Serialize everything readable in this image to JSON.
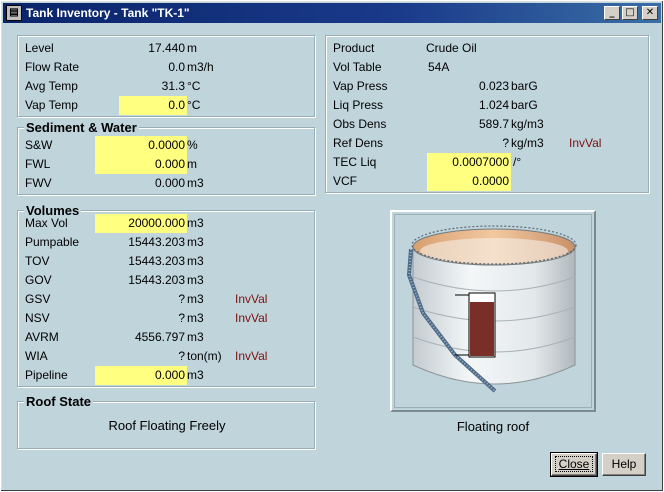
{
  "window": {
    "title": "Tank Inventory - Tank \"TK-1\"",
    "minimize_glyph": "_",
    "maximize_glyph": "□",
    "close_glyph": "✕"
  },
  "measurements": {
    "level": {
      "label": "Level",
      "value": "17.440",
      "unit": "m"
    },
    "flow_rate": {
      "label": "Flow Rate",
      "value": "0.0",
      "unit": "m3/h"
    },
    "avg_temp": {
      "label": "Avg Temp",
      "value": "31.3",
      "unit": "°C"
    },
    "vap_temp": {
      "label": "Vap Temp",
      "value": "0.0",
      "unit": "°C"
    }
  },
  "sediment": {
    "title": "Sediment & Water",
    "sw": {
      "label": "S&W",
      "value": "0.0000",
      "unit": "%"
    },
    "fwl": {
      "label": "FWL",
      "value": "0.000",
      "unit": "m"
    },
    "fwv": {
      "label": "FWV",
      "value": "0.000",
      "unit": "m3"
    }
  },
  "volumes": {
    "title": "Volumes",
    "max_vol": {
      "label": "Max Vol",
      "value": "20000.000",
      "unit": "m3"
    },
    "pumpable": {
      "label": "Pumpable",
      "value": "15443.203",
      "unit": "m3"
    },
    "tov": {
      "label": "TOV",
      "value": "15443.203",
      "unit": "m3"
    },
    "gov": {
      "label": "GOV",
      "value": "15443.203",
      "unit": "m3"
    },
    "gsv": {
      "label": "GSV",
      "value": "?",
      "unit": "m3",
      "status": "InvVal"
    },
    "nsv": {
      "label": "NSV",
      "value": "?",
      "unit": "m3",
      "status": "InvVal"
    },
    "avrm": {
      "label": "AVRM",
      "value": "4556.797",
      "unit": "m3"
    },
    "wia": {
      "label": "WIA",
      "value": "?",
      "unit": "ton(m)",
      "status": "InvVal"
    },
    "pipeline": {
      "label": "Pipeline",
      "value": "0.000",
      "unit": "m3"
    }
  },
  "roof": {
    "title": "Roof State",
    "state": "Roof Floating Freely"
  },
  "product": {
    "product": {
      "label": "Product",
      "value": "Crude Oil"
    },
    "vol_table": {
      "label": "Vol Table",
      "value": "54A"
    },
    "vap_press": {
      "label": "Vap Press",
      "value": "0.023",
      "unit": "barG"
    },
    "liq_press": {
      "label": "Liq Press",
      "value": "1.024",
      "unit": "barG"
    },
    "obs_dens": {
      "label": "Obs Dens",
      "value": "589.7",
      "unit": "kg/m3"
    },
    "ref_dens": {
      "label": "Ref Dens",
      "value": "?",
      "unit": "kg/m3",
      "status": "InvVal"
    },
    "tec_liq": {
      "label": "TEC Liq",
      "value": "0.0007000",
      "unit": "/°"
    },
    "vcf": {
      "label": "VCF",
      "value": "0.0000"
    }
  },
  "tank_image": {
    "caption": "Floating roof",
    "fill_level_fraction": 0.87,
    "colors": {
      "product": "#7a2e28",
      "shell": "#e8eef0"
    }
  },
  "buttons": {
    "close": "Close",
    "help": "Help"
  }
}
